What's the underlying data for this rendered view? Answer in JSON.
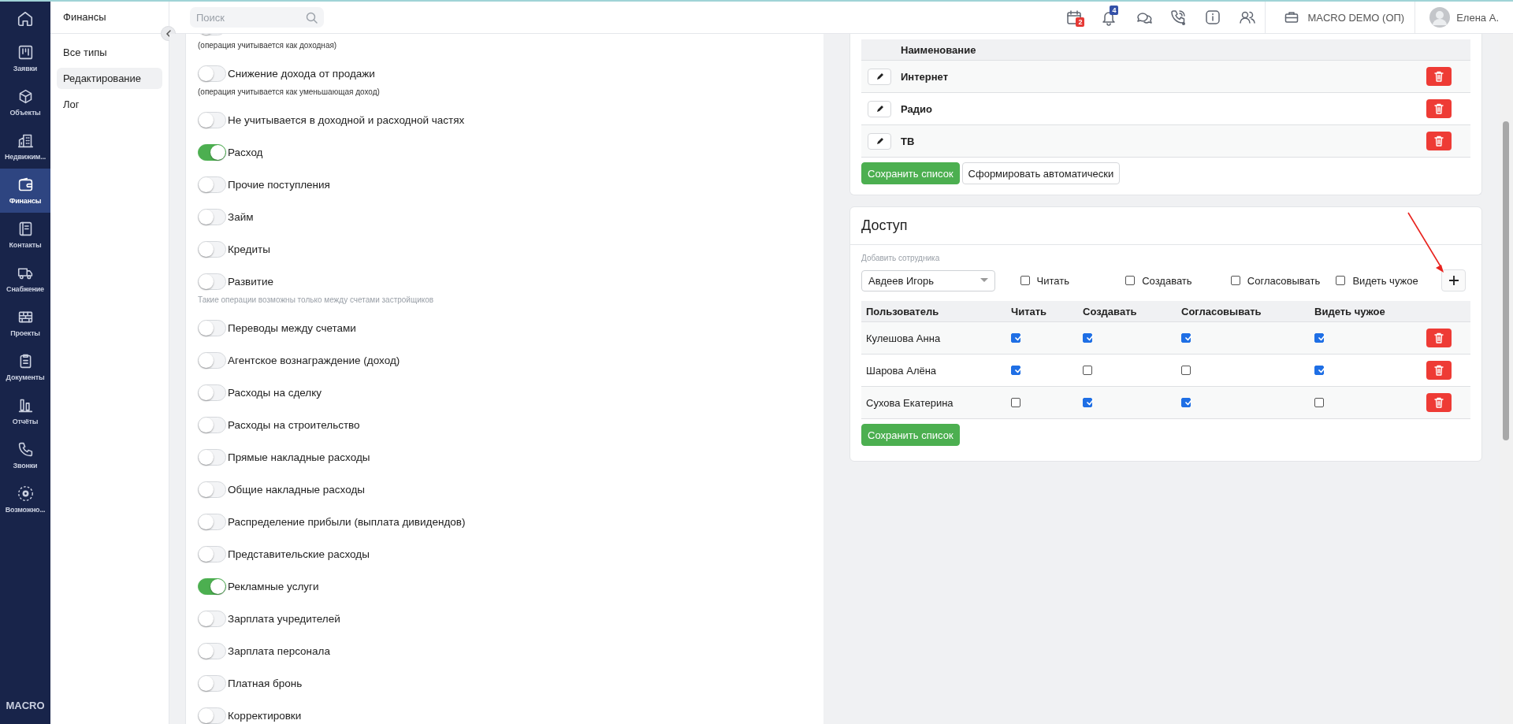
{
  "nav": {
    "items": [
      {
        "label": "Заявки",
        "selected": false
      },
      {
        "label": "Объекты",
        "selected": false
      },
      {
        "label": "Недвижим...",
        "selected": false
      },
      {
        "label": "Финансы",
        "selected": true
      },
      {
        "label": "Контакты",
        "selected": false
      },
      {
        "label": "Снабжение",
        "selected": false
      },
      {
        "label": "Проекты",
        "selected": false
      },
      {
        "label": "Документы",
        "selected": false
      },
      {
        "label": "Отчёты",
        "selected": false
      },
      {
        "label": "Звонки",
        "selected": false
      },
      {
        "label": "Возможно...",
        "selected": false
      }
    ],
    "brand": "MACRO"
  },
  "topbar": {
    "search": {
      "placeholder": "Поиск"
    },
    "calendar_badge": "2",
    "notification_badge": "4",
    "organization": "MACRO DEMO (ОП)",
    "user": "Елена А."
  },
  "subnav": {
    "title": "Финансы",
    "items": [
      {
        "label": "Все типы",
        "selected": false
      },
      {
        "label": "Редактирование",
        "selected": true
      },
      {
        "label": "Лог",
        "selected": false
      }
    ]
  },
  "operation_types": [
    {
      "on": false,
      "note": "(операция учитывается как доходная)",
      "note_greyed": false
    },
    {
      "label": "Снижение дохода от продажи",
      "on": false,
      "note": "(операция учитывается как уменьшающая доход)",
      "note_greyed": false
    },
    {
      "label": "Не учитывается в доходной и расходной частях",
      "on": false
    },
    {
      "label": "Расход",
      "on": true
    },
    {
      "label": "Прочие поступления",
      "on": false
    },
    {
      "label": "Займ",
      "on": false
    },
    {
      "label": "Кредиты",
      "on": false
    },
    {
      "label": "Развитие",
      "on": false,
      "note": "Такие операции возможны только между счетами застройщиков",
      "note_greyed": true
    },
    {
      "label": "Переводы между счетами",
      "on": false
    },
    {
      "label": "Агентское вознаграждение (доход)",
      "on": false
    },
    {
      "label": "Расходы на сделку",
      "on": false
    },
    {
      "label": "Расходы на строительство",
      "on": false
    },
    {
      "label": "Прямые накладные расходы",
      "on": false
    },
    {
      "label": "Общие накладные расходы",
      "on": false
    },
    {
      "label": "Распределение прибыли (выплата дивидендов)",
      "on": false
    },
    {
      "label": "Представительские расходы",
      "on": false
    },
    {
      "label": "Рекламные услуги",
      "on": true
    },
    {
      "label": "Зарплата учредителей",
      "on": false
    },
    {
      "label": "Зарплата персонала",
      "on": false
    },
    {
      "label": "Платная бронь",
      "on": false
    },
    {
      "label": "Корректировки",
      "on": false
    }
  ],
  "directory": {
    "columns": [
      "Наименование"
    ],
    "rows": [
      {
        "name": "Интернет"
      },
      {
        "name": "Радио"
      },
      {
        "name": "ТВ"
      }
    ],
    "buttons": [
      {
        "label": "Сохранить список",
        "kind": "primary"
      },
      {
        "label": "Сформировать автоматически",
        "kind": "secondary"
      }
    ]
  },
  "access": {
    "title": "Доступ",
    "add_label": "Добавить сотрудника",
    "employee": "Авдеев Игорь",
    "permissions": [
      {
        "label": "Читать",
        "checked": false
      },
      {
        "label": "Создавать",
        "checked": false
      },
      {
        "label": "Согласовывать",
        "checked": false
      },
      {
        "label": "Видеть чужое",
        "checked": false
      }
    ],
    "columns": [
      "Пользователь",
      "Читать",
      "Создавать",
      "Согласовывать",
      "Видеть чужое"
    ],
    "rows": [
      {
        "user": "Кулешова Анна",
        "permissions": [
          true,
          true,
          true,
          true
        ]
      },
      {
        "user": "Шарова Алёна",
        "permissions": [
          true,
          false,
          false,
          true
        ]
      },
      {
        "user": "Сухова Екатерина",
        "permissions": [
          false,
          true,
          true,
          false
        ]
      }
    ],
    "save": "Сохранить список"
  }
}
